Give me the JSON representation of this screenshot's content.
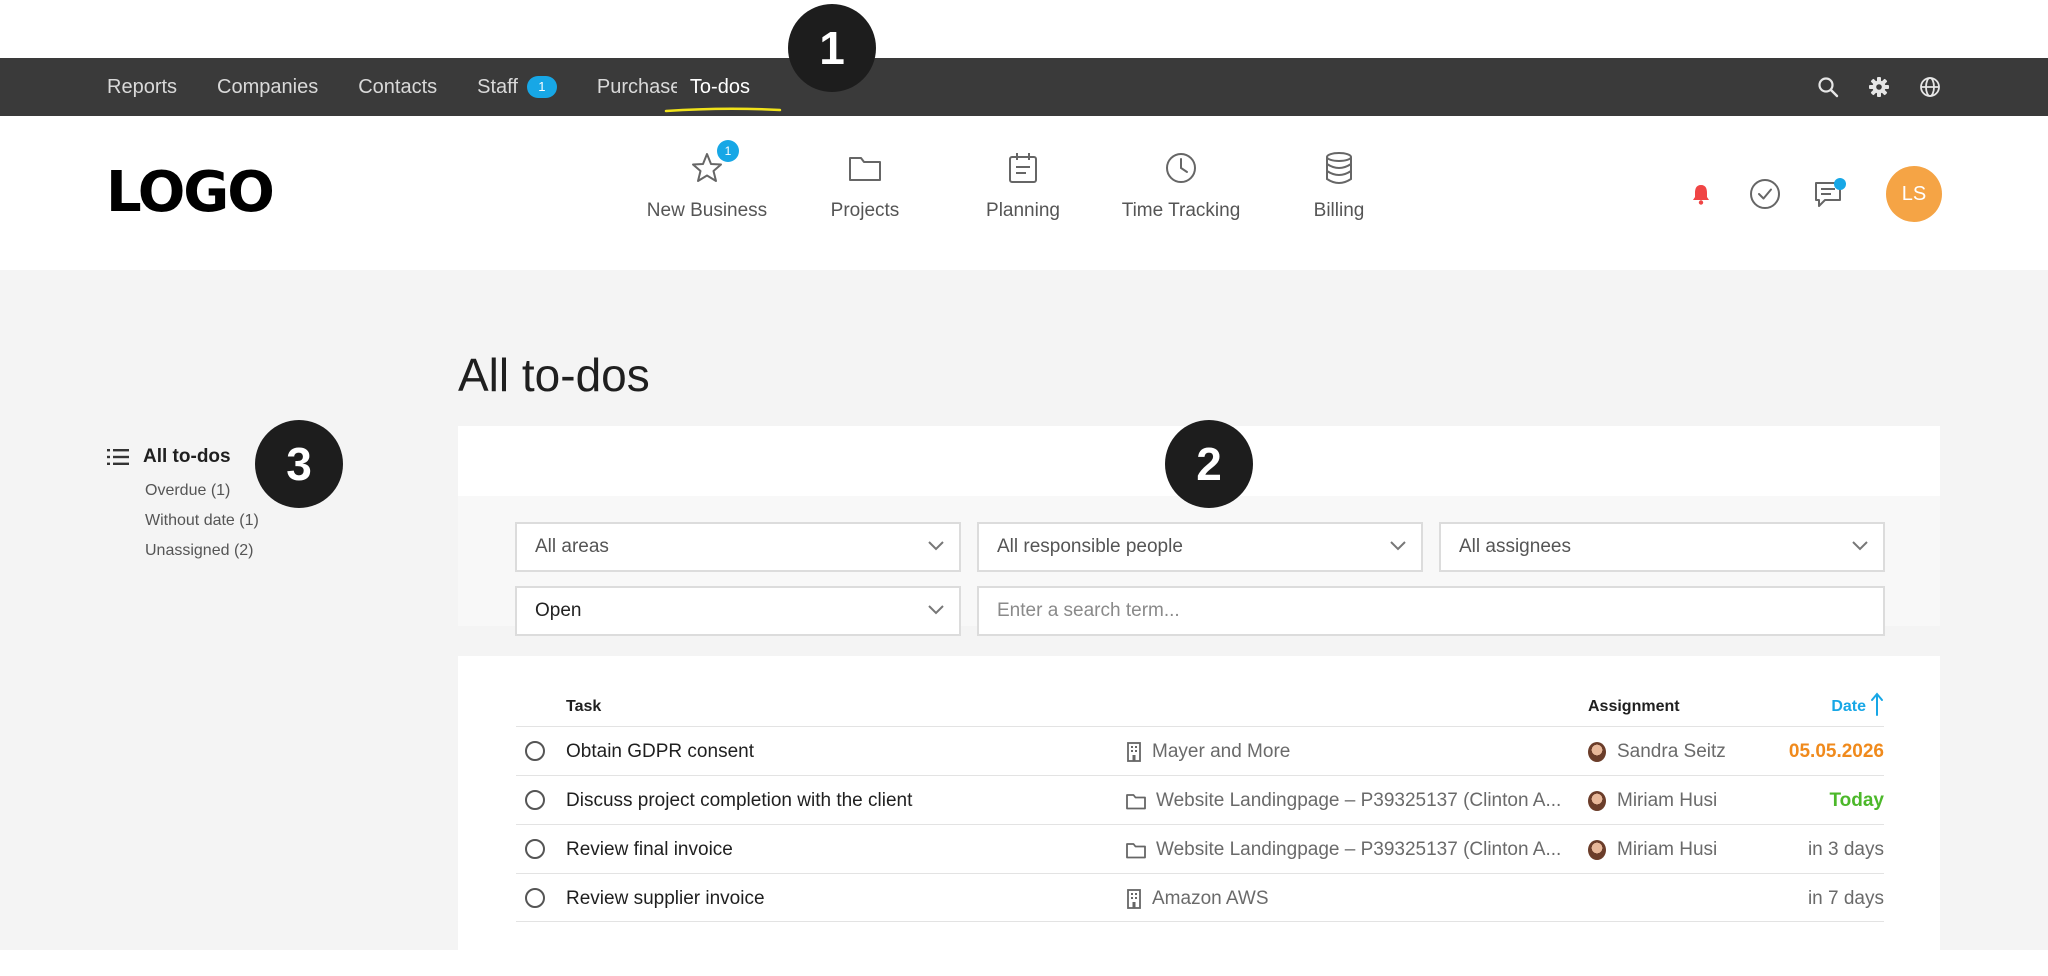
{
  "topbar": {
    "items": [
      {
        "label": "Reports"
      },
      {
        "label": "Companies"
      },
      {
        "label": "Contacts"
      },
      {
        "label": "Staff",
        "badge": "1"
      },
      {
        "label": "Purchase"
      },
      {
        "label": "To-dos"
      }
    ],
    "icons": [
      "search-icon",
      "gear-icon",
      "globe-icon"
    ]
  },
  "markers": {
    "one": "1",
    "two": "2",
    "three": "3"
  },
  "header": {
    "logo": "LOGO",
    "nav": [
      {
        "label": "New Business",
        "icon": "star-icon",
        "badge": "1"
      },
      {
        "label": "Projects",
        "icon": "folder-icon"
      },
      {
        "label": "Planning",
        "icon": "calendar-icon"
      },
      {
        "label": "Time Tracking",
        "icon": "clock-icon"
      },
      {
        "label": "Billing",
        "icon": "database-icon"
      }
    ],
    "avatar_initials": "LS"
  },
  "sidebar": {
    "title": "All to-dos",
    "items": [
      "Overdue (1)",
      "Without date (1)",
      "Unassigned (2)"
    ]
  },
  "main": {
    "title": "All to-dos",
    "filters": {
      "areas": "All areas",
      "responsible": "All responsible people",
      "assignees": "All assignees",
      "status": "Open",
      "search_placeholder": "Enter a search term..."
    },
    "table": {
      "headers": {
        "task": "Task",
        "assignment": "Assignment",
        "date": "Date"
      },
      "rows": [
        {
          "task": "Obtain GDPR consent",
          "project": "Mayer and More",
          "project_icon": "building-icon",
          "assignee": "Sandra Seitz",
          "date": "05.05.2026",
          "date_color": "#f08a1c"
        },
        {
          "task": "Discuss project completion with the client",
          "project": "Website Landingpage – P39325137 (Clinton A...",
          "project_icon": "folder-icon",
          "assignee": "Miriam Husi",
          "date": "Today",
          "date_color": "#4cb82a"
        },
        {
          "task": "Review final invoice",
          "project": "Website Landingpage – P39325137 (Clinton A...",
          "project_icon": "folder-icon",
          "assignee": "Miriam Husi",
          "date": "in 3 days",
          "date_color": "#6a6a6a"
        },
        {
          "task": "Review supplier invoice",
          "project": "Amazon AWS",
          "project_icon": "building-icon",
          "assignee": "",
          "date": "in 7 days",
          "date_color": "#6a6a6a"
        }
      ]
    }
  },
  "colors": {
    "accent": "#17a7e6",
    "topbar": "#3a3a3a",
    "avatar": "#f5a445",
    "highlight": "#f0e21a"
  }
}
